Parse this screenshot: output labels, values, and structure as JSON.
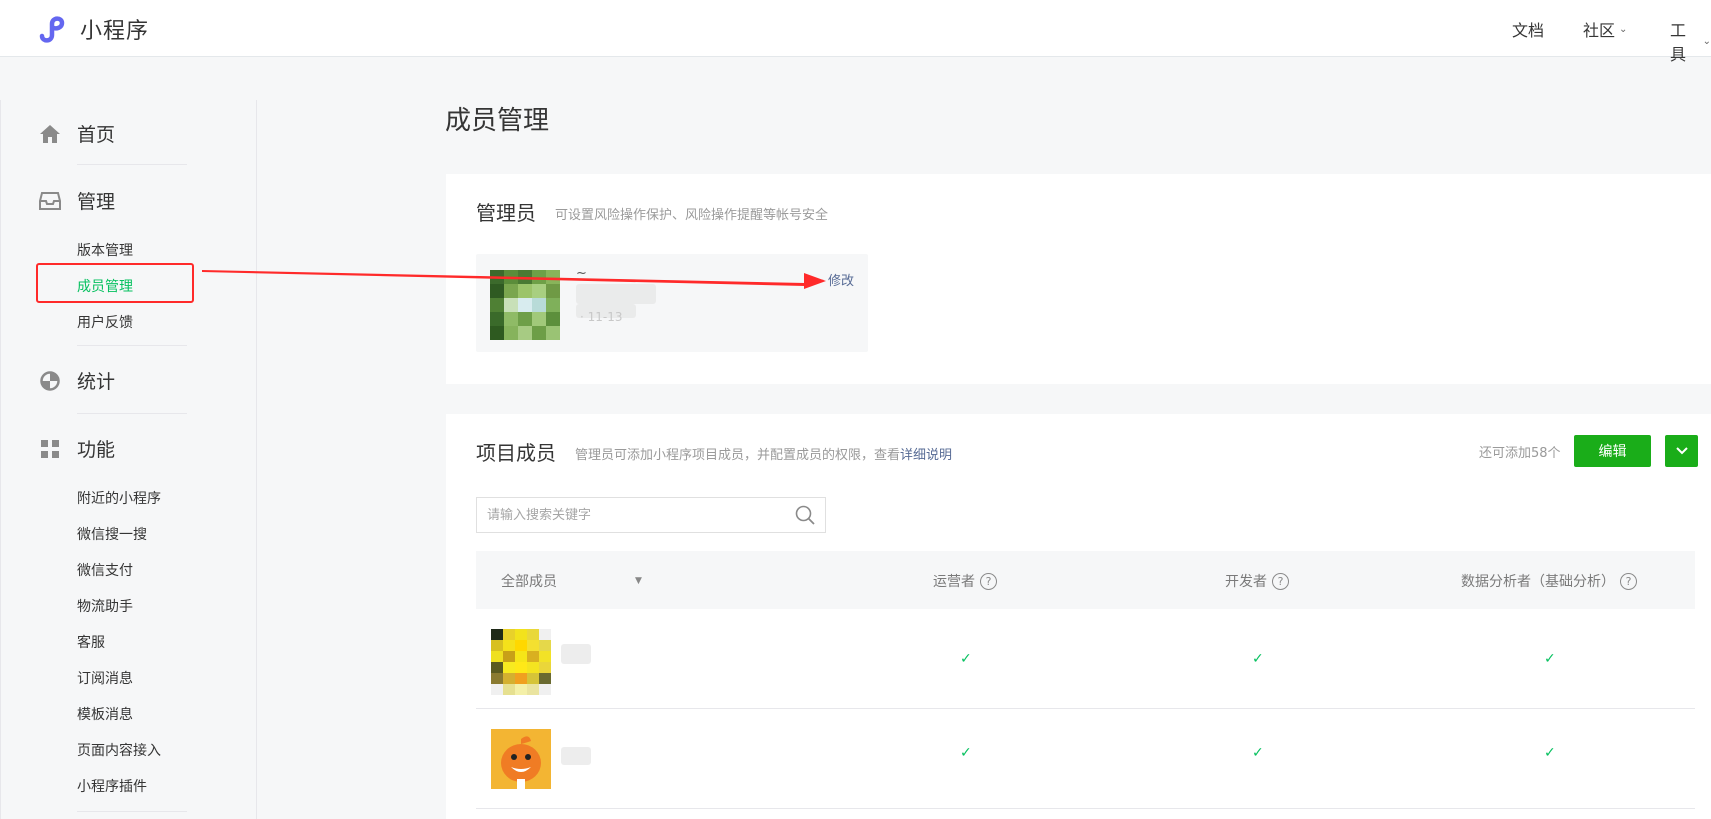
{
  "topbar": {
    "logo_text": "小程序",
    "nav": [
      {
        "label": "文档"
      },
      {
        "label": "社区"
      },
      {
        "label": "工具"
      }
    ]
  },
  "sidebar": {
    "sections": [
      {
        "label": "首页",
        "icon": "home-icon"
      },
      {
        "label": "管理",
        "icon": "inbox-icon",
        "items": [
          "版本管理",
          "成员管理",
          "用户反馈"
        ]
      },
      {
        "label": "统计",
        "icon": "pie-chart-icon"
      },
      {
        "label": "功能",
        "icon": "grid-icon",
        "items": [
          "附近的小程序",
          "微信搜一搜",
          "微信支付",
          "物流助手",
          "客服",
          "订阅消息",
          "模板消息",
          "页面内容接入",
          "小程序插件"
        ]
      }
    ],
    "active_item": "成员管理"
  },
  "main": {
    "title": "成员管理",
    "admin": {
      "title": "管理员",
      "desc": "可设置风险操作保护、风险操作提醒等帐号安全",
      "name": "~",
      "date": "· 11-13",
      "modify_link": "修改"
    },
    "members": {
      "title": "项目成员",
      "desc": "管理员可添加小程序项目成员，并配置成员的权限，查看",
      "desc_link": "详细说明",
      "remaining": "还可添加58个",
      "edit_button": "编辑",
      "search_placeholder": "请输入搜索关键字",
      "columns": {
        "all": "全部成员",
        "operator": "运营者",
        "developer": "开发者",
        "analyst": "数据分析者（基础分析）"
      },
      "rows": [
        {
          "operator": "✓",
          "developer": "✓",
          "analyst": "✓"
        },
        {
          "operator": "✓",
          "developer": "✓",
          "analyst": "✓"
        }
      ]
    }
  },
  "colors": {
    "accent_green": "#07c160",
    "button_green": "#1aad19",
    "link_blue": "#576b95",
    "annotation_red": "#ff2a2a"
  }
}
